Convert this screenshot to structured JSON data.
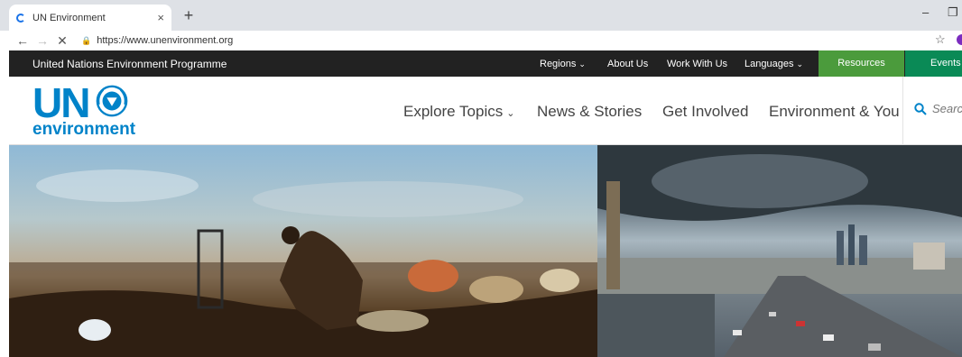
{
  "browser": {
    "tab_title": "UN Environment",
    "tab_close": "×",
    "new_tab": "+",
    "back": "←",
    "forward": "→",
    "stop": "✕",
    "url": "https://www.unenvironment.org",
    "minimize": "–",
    "restore": "❐",
    "star": "☆"
  },
  "topbar": {
    "org_name": "United Nations Environment Programme",
    "regions": "Regions",
    "about": "About Us",
    "work": "Work With Us",
    "languages": "Languages",
    "resources": "Resources",
    "events": "Events",
    "chevron": "⌄",
    "resources_color": "#4b9b3c",
    "events_color": "#0a8a56"
  },
  "header": {
    "logo_un": "UN",
    "logo_environment": "environment",
    "nav": {
      "explore": "Explore Topics",
      "news": "News & Stories",
      "involved": "Get Involved",
      "env_you": "Environment & You"
    },
    "chevron": "⌄",
    "search_icon": "🔍",
    "search_placeholder": "Search",
    "brand_color": "#0083c9"
  },
  "hero": {
    "left_image": "man sorting through waste at a landfill at dusk",
    "right_image": "city highway traffic under cloudy sky"
  }
}
